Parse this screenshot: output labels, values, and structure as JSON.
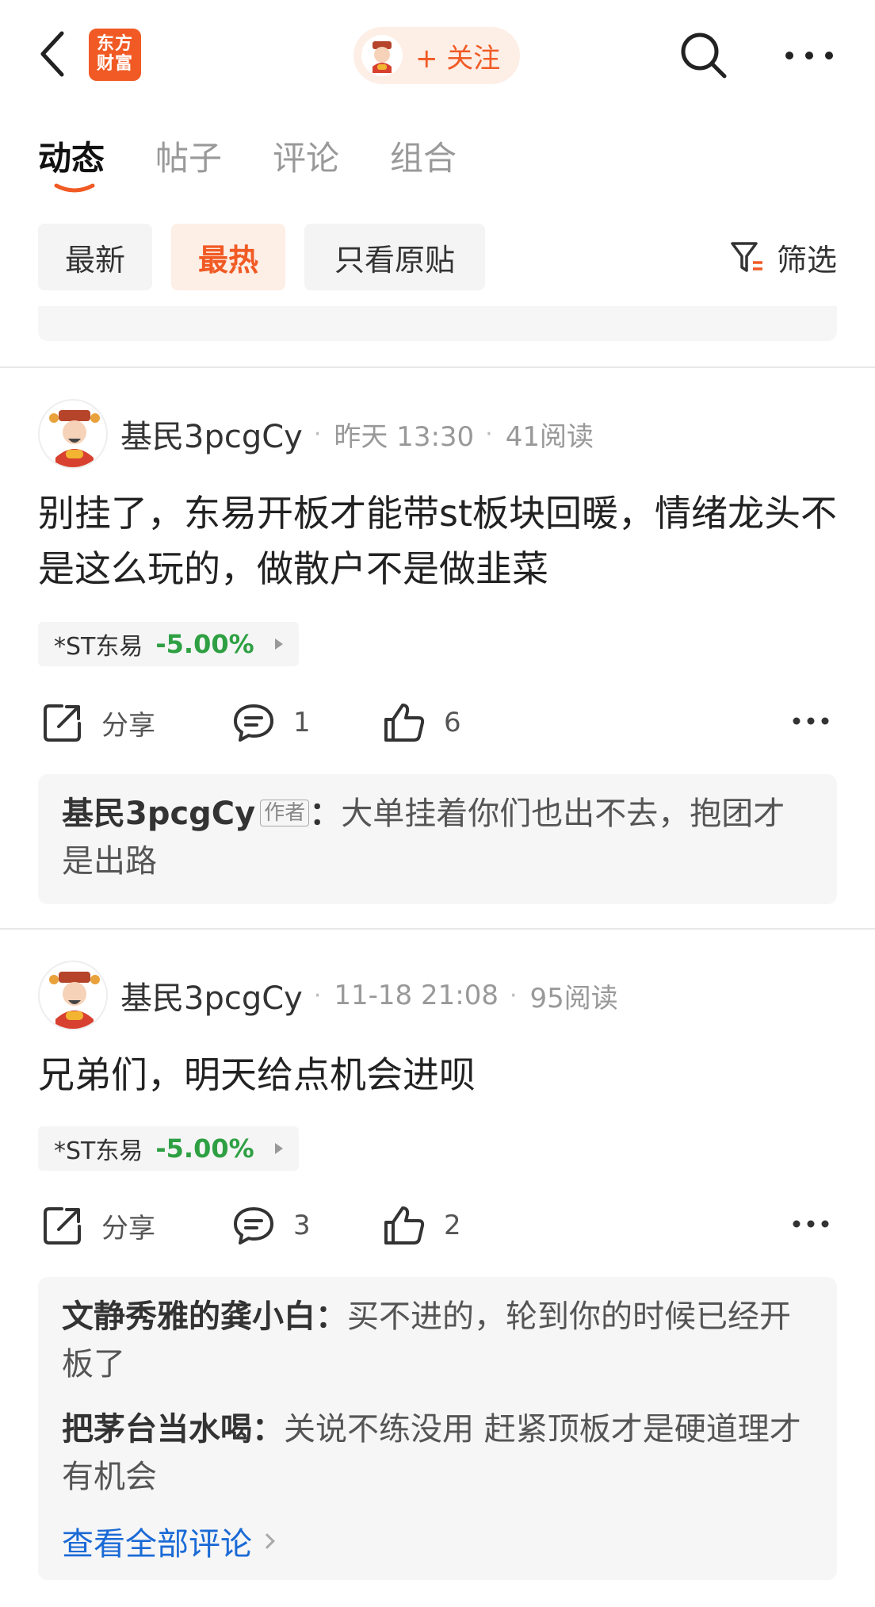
{
  "header": {
    "logo_line1": "东方",
    "logo_line2": "财富",
    "follow_label": "+ 关注"
  },
  "tabs": [
    {
      "label": "动态",
      "active": true
    },
    {
      "label": "帖子",
      "active": false
    },
    {
      "label": "评论",
      "active": false
    },
    {
      "label": "组合",
      "active": false
    }
  ],
  "filters": {
    "chips": [
      {
        "label": "最新",
        "active": false
      },
      {
        "label": "最热",
        "active": true
      },
      {
        "label": "只看原贴",
        "active": false
      }
    ],
    "filter_label": "筛选"
  },
  "colors": {
    "brand": "#f15a24",
    "stock_down": "#2ea043",
    "link": "#1a6ad6"
  },
  "posts": [
    {
      "author": "基民3pcgCy",
      "time": "昨天 13:30",
      "reads": "41阅读",
      "text": "别挂了，东易开板才能带st板块回暖，情绪龙头不是这么玩的，做散户不是做韭菜",
      "stock": {
        "name": "*ST东易",
        "change": "-5.00%"
      },
      "actions": {
        "share": "分享",
        "comments": "1",
        "likes": "6"
      },
      "replies": [
        {
          "name": "基民3pcgCy",
          "badge": "作者",
          "text": "大单挂着你们也出不去，抱团才是出路"
        }
      ]
    },
    {
      "author": "基民3pcgCy",
      "time": "11-18 21:08",
      "reads": "95阅读",
      "text": "兄弟们，明天给点机会进呗",
      "stock": {
        "name": "*ST东易",
        "change": "-5.00%"
      },
      "actions": {
        "share": "分享",
        "comments": "3",
        "likes": "2"
      },
      "replies": [
        {
          "name": "文静秀雅的龚小白",
          "text": "买不进的，轮到你的时候已经开板了"
        },
        {
          "name": "把茅台当水喝",
          "text": "关说不练没用 赶紧顶板才是硬道理才有机会"
        }
      ],
      "view_all": "查看全部评论"
    }
  ]
}
